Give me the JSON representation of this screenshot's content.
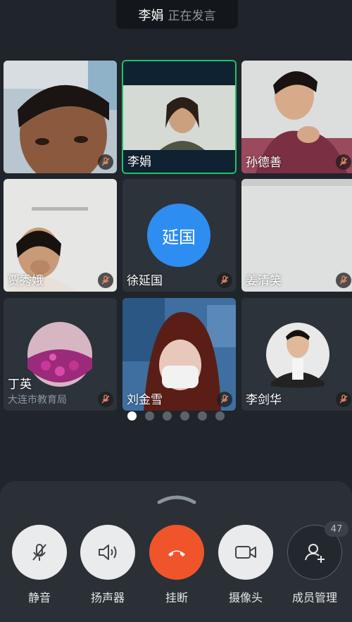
{
  "header": {
    "speaker_name": "李娟",
    "speaker_status": "正在发言"
  },
  "participants": [
    {
      "name": "",
      "muted": true
    },
    {
      "name": "李娟",
      "muted": false,
      "active": true
    },
    {
      "name": "孙德善",
      "muted": true
    },
    {
      "name": "贾秀娥",
      "muted": true
    },
    {
      "name": "徐延国",
      "avatar_text": "延国",
      "muted": true
    },
    {
      "name": "姜清笑",
      "muted": true
    },
    {
      "name": "丁英",
      "org": "大连市教育局",
      "muted": true
    },
    {
      "name": "刘金雪",
      "muted": true
    },
    {
      "name": "李剑华",
      "muted": true
    }
  ],
  "pager": {
    "total": 6,
    "current": 1
  },
  "controls": {
    "mute_label": "静音",
    "speaker_label": "扬声器",
    "hangup_label": "挂断",
    "camera_label": "摄像头",
    "members_label": "成员管理",
    "member_count": "47"
  },
  "colors": {
    "active_border": "#1fc26a",
    "hangup": "#f0542b",
    "avatar_blue": "#2e8df0"
  }
}
